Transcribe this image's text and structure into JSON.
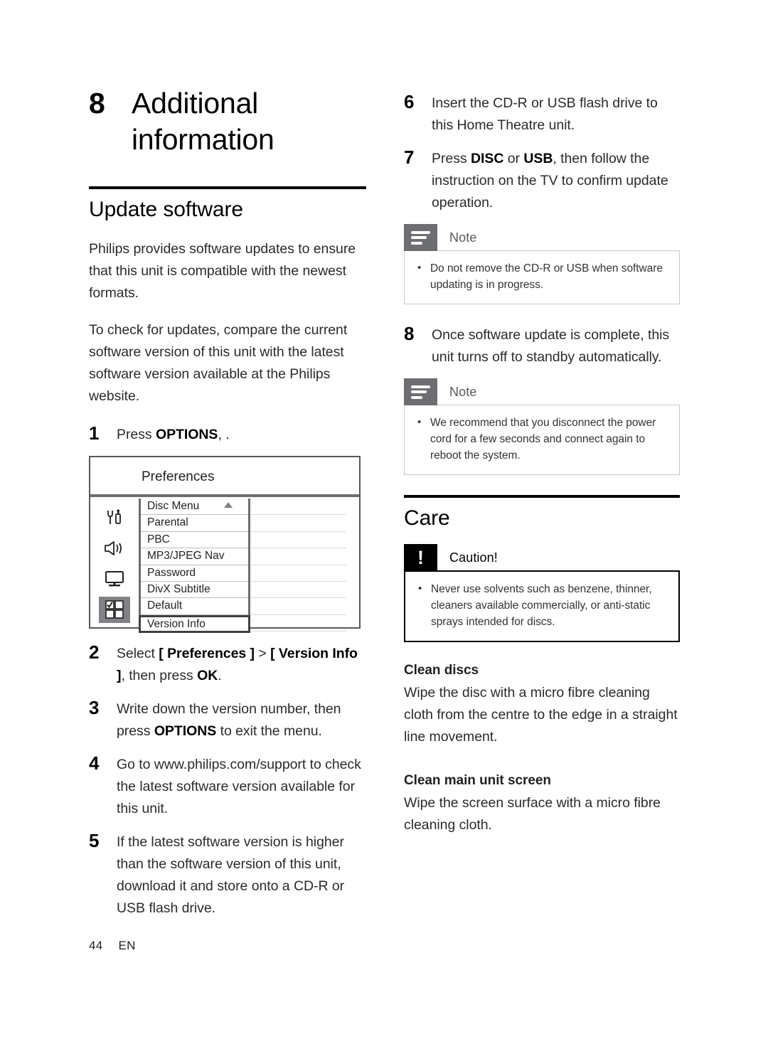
{
  "chapter": {
    "number": "8",
    "title_line1": "Additional",
    "title_line2": "information"
  },
  "left_column": {
    "section_heading": "Update software",
    "paragraphs": [
      "Philips provides software updates to ensure that this unit is compatible with the newest formats.",
      "To check for updates, compare the current software version of this unit with the latest software version available at the Philips website."
    ],
    "steps": [
      {
        "num": "1",
        "text": "Press OPTIONS, .",
        "bold_parts": [
          "OPTIONS"
        ]
      },
      {
        "num": "2",
        "text": "Select [ Preferences ] > [ Version Info ], then press OK.",
        "bold_parts": [
          "[ Preferences ]",
          "[ Version Info ]",
          "OK"
        ]
      },
      {
        "num": "3",
        "text": "Write down the version number, then press OPTIONS to exit the menu.",
        "bold_parts": [
          "OPTIONS"
        ]
      },
      {
        "num": "4",
        "text": "Go to www.philips.com/support to check the latest software version available for this unit.",
        "bold_parts": []
      },
      {
        "num": "5",
        "text": "If the latest software version is higher than the software version of this unit, download it and store onto a CD-R or USB flash drive.",
        "bold_parts": []
      }
    ],
    "screenshot": {
      "title": "Preferences",
      "icons": [
        {
          "name": "setup-tools-icon",
          "selected": false
        },
        {
          "name": "audio-speaker-icon",
          "selected": false
        },
        {
          "name": "video-tv-icon",
          "selected": false
        },
        {
          "name": "preferences-grid-icon",
          "selected": true
        }
      ],
      "menu_items": [
        {
          "label": "Disc Menu",
          "caret": true,
          "active": false
        },
        {
          "label": "Parental",
          "caret": false,
          "active": false
        },
        {
          "label": "PBC",
          "caret": false,
          "active": false
        },
        {
          "label": "MP3/JPEG Nav",
          "caret": false,
          "active": false
        },
        {
          "label": "Password",
          "caret": false,
          "active": false
        },
        {
          "label": "DivX Subtitle",
          "caret": false,
          "active": false
        },
        {
          "label": "Default",
          "caret": false,
          "active": false
        },
        {
          "label": "Version Info",
          "caret": false,
          "active": true
        }
      ]
    }
  },
  "right_column": {
    "steps_top": [
      {
        "num": "6",
        "text": "Insert the CD-R or USB flash drive to this Home Theatre unit."
      },
      {
        "num": "7",
        "text": "Press DISC or USB, then follow the instruction on the TV to confirm update operation."
      }
    ],
    "note1": {
      "label": "Note",
      "icon": "note-lines-icon",
      "items": [
        "Do not remove the CD-R or USB when software updating is in progress."
      ]
    },
    "step8": {
      "num": "8",
      "text": "Once software update is complete, this unit turns off to standby automatically."
    },
    "note2": {
      "label": "Note",
      "icon": "note-lines-icon",
      "items": [
        "We recommend that you disconnect the power cord for a few seconds and connect again to reboot the system."
      ]
    },
    "care_heading": "Care",
    "caution": {
      "label": "Caution!",
      "icon": "exclamation-icon",
      "items": [
        "Never use solvents such as benzene, thinner, cleaners available commercially, or anti-static sprays intended for discs."
      ]
    },
    "subsections": [
      {
        "heading": "Clean discs",
        "body": "Wipe the disc with a micro fibre cleaning cloth from the centre to the edge in a straight line movement."
      },
      {
        "heading": "Clean main unit screen",
        "body": "Wipe the screen surface with a micro fibre cleaning cloth."
      }
    ]
  },
  "footer": {
    "page_number": "44",
    "language": "EN"
  },
  "colors": {
    "text": "#231f20",
    "note_badge": "#6d6e71",
    "caution_badge": "#000000",
    "rule": "#000000",
    "menu_border": "#58595b"
  }
}
